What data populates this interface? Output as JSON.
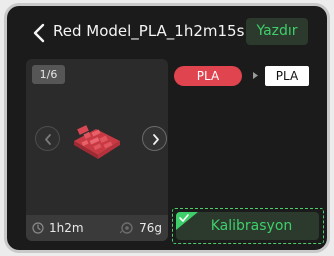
{
  "header": {
    "title": "Red Model_PLA_1h2m15s",
    "print_label": "Yazdır",
    "back_icon": "chevron-left-icon"
  },
  "preview": {
    "page_indicator": "1/6",
    "prev_icon": "chevron-left-icon",
    "next_icon": "chevron-right-icon",
    "model_color": "#d9434c"
  },
  "stats": {
    "time_icon": "clock-icon",
    "time": "1h2m",
    "weight_icon": "filament-icon",
    "weight": "76g"
  },
  "filament_mapping": {
    "source_label": "PLA",
    "source_color": "#e0454f",
    "target_label": "PLA",
    "target_color": "#ffffff"
  },
  "calibration": {
    "label": "Kalibrasyon",
    "checked": true,
    "accent": "#3fcf6a"
  }
}
